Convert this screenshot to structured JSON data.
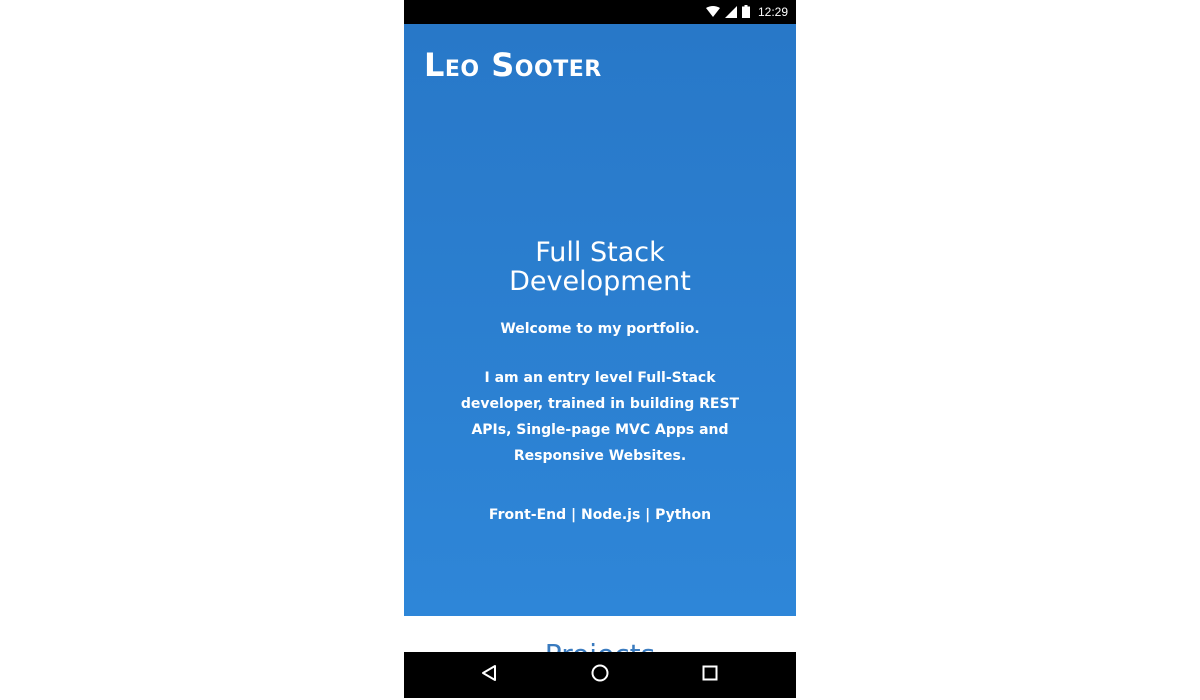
{
  "status_bar": {
    "time": "12:29",
    "icons": [
      "wifi-icon",
      "signal-icon",
      "battery-icon"
    ]
  },
  "site": {
    "brand": "Leo Sooter"
  },
  "hero": {
    "headline_line1": "Full Stack",
    "headline_line2": "Development",
    "welcome": "Welcome to my portfolio.",
    "intro": "I am an entry level Full-Stack developer, trained in building REST APIs, Single-page MVC Apps and Responsive Websites.",
    "skills": "Front-End | Node.js | Python"
  },
  "projects": {
    "heading": "Projects"
  },
  "nav_bar": {
    "icons": [
      "back-icon",
      "home-icon",
      "recents-icon"
    ]
  },
  "colors": {
    "hero_background": "#2a7fd0",
    "projects_heading": "#3a7bbf",
    "system_bars": "#000000"
  }
}
